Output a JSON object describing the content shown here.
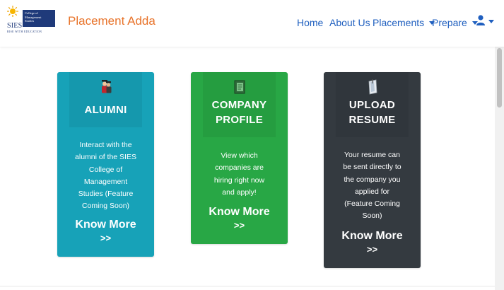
{
  "header": {
    "logo": {
      "wordmark": "SIES",
      "box_lines": [
        "College of",
        "Management",
        "Studies"
      ],
      "tagline": "RISE WITH EDUCATION"
    },
    "brand": "Placement Adda",
    "nav": [
      {
        "label": "Home",
        "dropdown": false
      },
      {
        "label": "About Us",
        "dropdown": false
      },
      {
        "label": "Placements",
        "dropdown": true
      },
      {
        "label": "Prepare",
        "dropdown": true
      }
    ],
    "user_menu": {
      "icon": "user-icon",
      "dropdown": true
    }
  },
  "cards": [
    {
      "id": "alumni",
      "icon": "graduates-icon",
      "title": "ALUMNI",
      "text_lines": [
        "Interact with the",
        "alumni of the SIES",
        "College of",
        "Management",
        "Studies (Feature",
        "Coming Soon)"
      ],
      "link": "Know More",
      "link_arrows": ">>",
      "color": "#17a2b8"
    },
    {
      "id": "company",
      "icon": "notebook-icon",
      "title_lines": [
        "COMPANY",
        "PROFILE"
      ],
      "text_lines": [
        "View which",
        "companies are",
        "hiring right now",
        "and apply!"
      ],
      "link": "Know More",
      "link_arrows": ">>",
      "color": "#28a745"
    },
    {
      "id": "resume",
      "icon": "document-icon",
      "title_lines": [
        "UPLOAD",
        "RESUME"
      ],
      "text_lines": [
        "Your resume can",
        "be sent directly to",
        "the company you",
        "applied for",
        "(Feature Coming",
        "Soon)"
      ],
      "link": "Know More",
      "link_arrows": ">>",
      "color": "#343a40"
    }
  ],
  "colors": {
    "brand": "#e8732a",
    "nav_link": "#1f5fbf"
  }
}
